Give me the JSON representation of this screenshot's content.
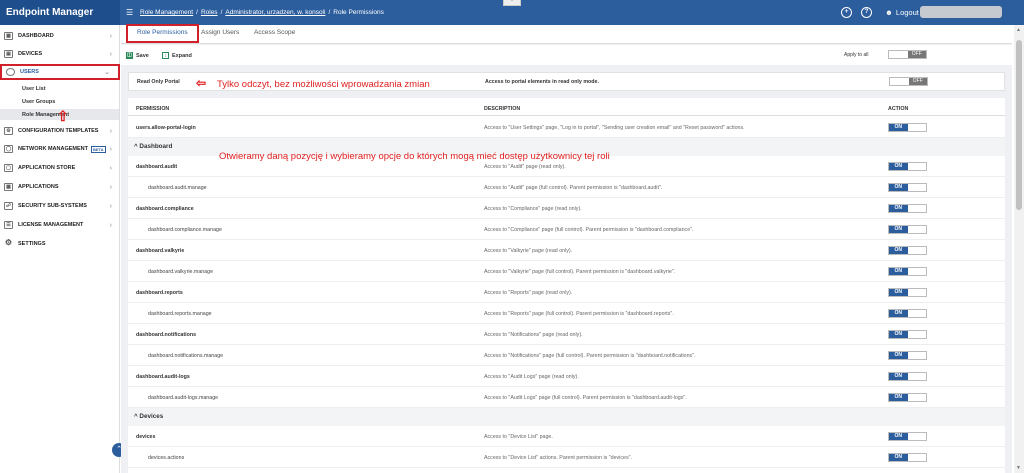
{
  "app": {
    "title": "Endpoint Manager"
  },
  "topbar": {
    "breadcrumbs": [
      "Role Management",
      "Roles",
      "Administrator, urzadzen, w. konsoli",
      "Role Permissions"
    ],
    "separator": "/",
    "logout_label": "Logout"
  },
  "sidebar": {
    "items": [
      {
        "label": "DASHBOARD",
        "icon": "dashboard-icon"
      },
      {
        "label": "DEVICES",
        "icon": "devices-icon"
      },
      {
        "label": "USERS",
        "icon": "user-icon"
      },
      {
        "label": "CONFIGURATION TEMPLATES",
        "icon": "config-icon"
      },
      {
        "label": "NETWORK MANAGEMENT",
        "icon": "network-icon",
        "badge": "BETA"
      },
      {
        "label": "APPLICATION STORE",
        "icon": "store-icon"
      },
      {
        "label": "APPLICATIONS",
        "icon": "apps-icon"
      },
      {
        "label": "SECURITY SUB-SYSTEMS",
        "icon": "security-icon"
      },
      {
        "label": "LICENSE MANAGEMENT",
        "icon": "license-icon"
      },
      {
        "label": "SETTINGS",
        "icon": "gear-icon"
      }
    ],
    "users_sub": [
      "User List",
      "User Groups",
      "Role Management"
    ]
  },
  "tabs": [
    "Role Permissions",
    "Assign Users",
    "Access Scope"
  ],
  "toolbar": {
    "save": "Save",
    "expand": "Expand",
    "apply_all": "Apply to all",
    "toggle_off": "OFF"
  },
  "read_only": {
    "label": "Read Only Portal",
    "desc": "Access to portal elements in read only mode.",
    "toggle": "OFF"
  },
  "annotations": {
    "readonly_note": "Tylko odczyt, bez możliwości wprowadzania zmian",
    "dashboard_note": "Otwieramy daną pozycję i wybieramy opcje do których mogą mieć dostęp użytkownicy tej roli"
  },
  "table": {
    "headers": {
      "permission": "PERMISSION",
      "description": "DESCRIPTION",
      "action": "ACTION"
    },
    "toggle_on": "ON",
    "rows": [
      {
        "type": "perm",
        "level": "parent",
        "perm": "users.allow-portal-login",
        "desc": "Access to \"User Settings\" page, \"Log in to portal\", \"Sending user creation email\" and \"Reset password\" actions."
      },
      {
        "type": "group",
        "label": "^ Dashboard"
      },
      {
        "type": "perm",
        "level": "parent",
        "perm": "dashboard.audit",
        "desc": "Access to \"Audit\" page (read only)."
      },
      {
        "type": "perm",
        "level": "child",
        "perm": "dashboard.audit.manage",
        "desc": "Access to \"Audit\" page (full control). Parent permission is \"dashboard.audit\"."
      },
      {
        "type": "perm",
        "level": "parent",
        "perm": "dashboard.compliance",
        "desc": "Access to \"Compliance\" page (read only)."
      },
      {
        "type": "perm",
        "level": "child",
        "perm": "dashboard.compliance.manage",
        "desc": "Access to \"Compliance\" page (full control). Parent permission is \"dashboard.compliance\"."
      },
      {
        "type": "perm",
        "level": "parent",
        "perm": "dashboard.valkyrie",
        "desc": "Access to \"Valkyrie\" page (read only)."
      },
      {
        "type": "perm",
        "level": "child",
        "perm": "dashboard.valkyrie.manage",
        "desc": "Access to \"Valkyrie\" page (full control). Parent permission is \"dashboard.valkyrie\"."
      },
      {
        "type": "perm",
        "level": "parent",
        "perm": "dashboard.reports",
        "desc": "Access to \"Reports\" page (read only)."
      },
      {
        "type": "perm",
        "level": "child",
        "perm": "dashboard.reports.manage",
        "desc": "Access to \"Reports\" page (full control). Parent permission is \"dashboard.reports\"."
      },
      {
        "type": "perm",
        "level": "parent",
        "perm": "dashboard.notifications",
        "desc": "Access to \"Notifications\" page (read only)."
      },
      {
        "type": "perm",
        "level": "child",
        "perm": "dashboard.notifications.manage",
        "desc": "Access to \"Notifications\" page (full control). Parent permission is \"dashboard.notifications\"."
      },
      {
        "type": "perm",
        "level": "parent",
        "perm": "dashboard.audit-logs",
        "desc": "Access to \"Audit Logs\" page (read only)."
      },
      {
        "type": "perm",
        "level": "child",
        "perm": "dashboard.audit-logs.manage",
        "desc": "Access to \"Audit Logs\" page (full control). Parent permission is \"dashboard.audit-logs\"."
      },
      {
        "type": "group",
        "label": "^ Devices"
      },
      {
        "type": "perm",
        "level": "parent",
        "perm": "devices",
        "desc": "Access to \"Device List\" page."
      },
      {
        "type": "perm",
        "level": "child",
        "perm": "devices.actions",
        "desc": "Access to \"Device List\" actions. Parent permission is \"devices\"."
      }
    ]
  },
  "colors": {
    "brand": "#2c5e9e",
    "annotation": "#e02020"
  }
}
